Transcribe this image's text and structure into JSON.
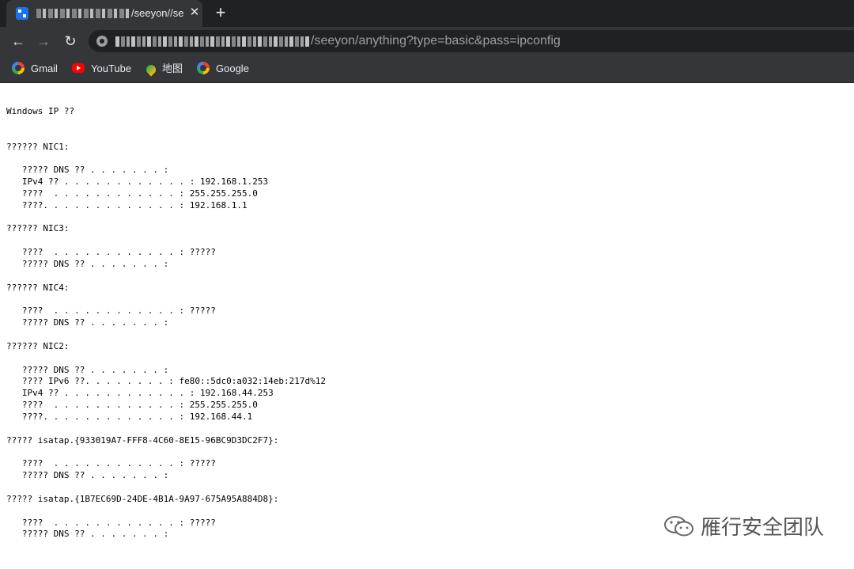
{
  "browser": {
    "tab": {
      "title": "/seeyon//se"
    },
    "address_bar": {
      "url_path": "/seeyon/anything?type=basic&pass=ipconfig"
    },
    "bookmarks": [
      "Gmail",
      "YouTube",
      "地图",
      "Google"
    ]
  },
  "page": {
    "output": "Windows IP ??\n\n\n?????? NIC1:\n\n   ????? DNS ?? . . . . . . . :\n   IPv4 ?? . . . . . . . . . . . . : 192.168.1.253\n   ????  . . . . . . . . . . . . : 255.255.255.0\n   ????. . . . . . . . . . . . . : 192.168.1.1\n\n?????? NIC3:\n\n   ????  . . . . . . . . . . . . : ?????\n   ????? DNS ?? . . . . . . . :\n\n?????? NIC4:\n\n   ????  . . . . . . . . . . . . : ?????\n   ????? DNS ?? . . . . . . . :\n\n?????? NIC2:\n\n   ????? DNS ?? . . . . . . . :\n   ???? IPv6 ??. . . . . . . . : fe80::5dc0:a032:14eb:217d%12\n   IPv4 ?? . . . . . . . . . . . . : 192.168.44.253\n   ????  . . . . . . . . . . . . : 255.255.255.0\n   ????. . . . . . . . . . . . . : 192.168.44.1\n\n????? isatap.{933019A7-FFF8-4C60-8E15-96BC9D3DC2F7}:\n\n   ????  . . . . . . . . . . . . : ?????\n   ????? DNS ?? . . . . . . . :\n\n????? isatap.{1B7EC69D-24DE-4B1A-9A97-675A95A884D8}:\n\n   ????  . . . . . . . . . . . . : ?????\n   ????? DNS ?? . . . . . . . :"
  },
  "watermark": {
    "text": "雁行安全团队"
  }
}
